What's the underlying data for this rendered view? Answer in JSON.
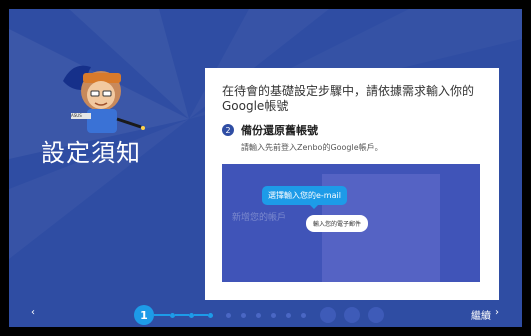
{
  "screen": {
    "title": "設定須知",
    "intro": "在待會的基礎設定步驟中，請依據需求輸入你的Google帳號",
    "step": {
      "number": "2",
      "title": "備份還原舊帳號",
      "description": "請輸入先前登入Zenbo的Google帳戶。"
    }
  },
  "mascot": {
    "badge_text": "ASUS"
  },
  "preview": {
    "bubble_text": "選擇輸入您的e-mail",
    "pill_text": "輸入您的電子郵件",
    "bg_text": "新增您的帳戶"
  },
  "footer": {
    "back_label": "‹",
    "current_step": "1",
    "next_label": "繼續",
    "next_arrow": "›"
  },
  "colors": {
    "background": "#2f4da3",
    "accent": "#1d9be8"
  }
}
